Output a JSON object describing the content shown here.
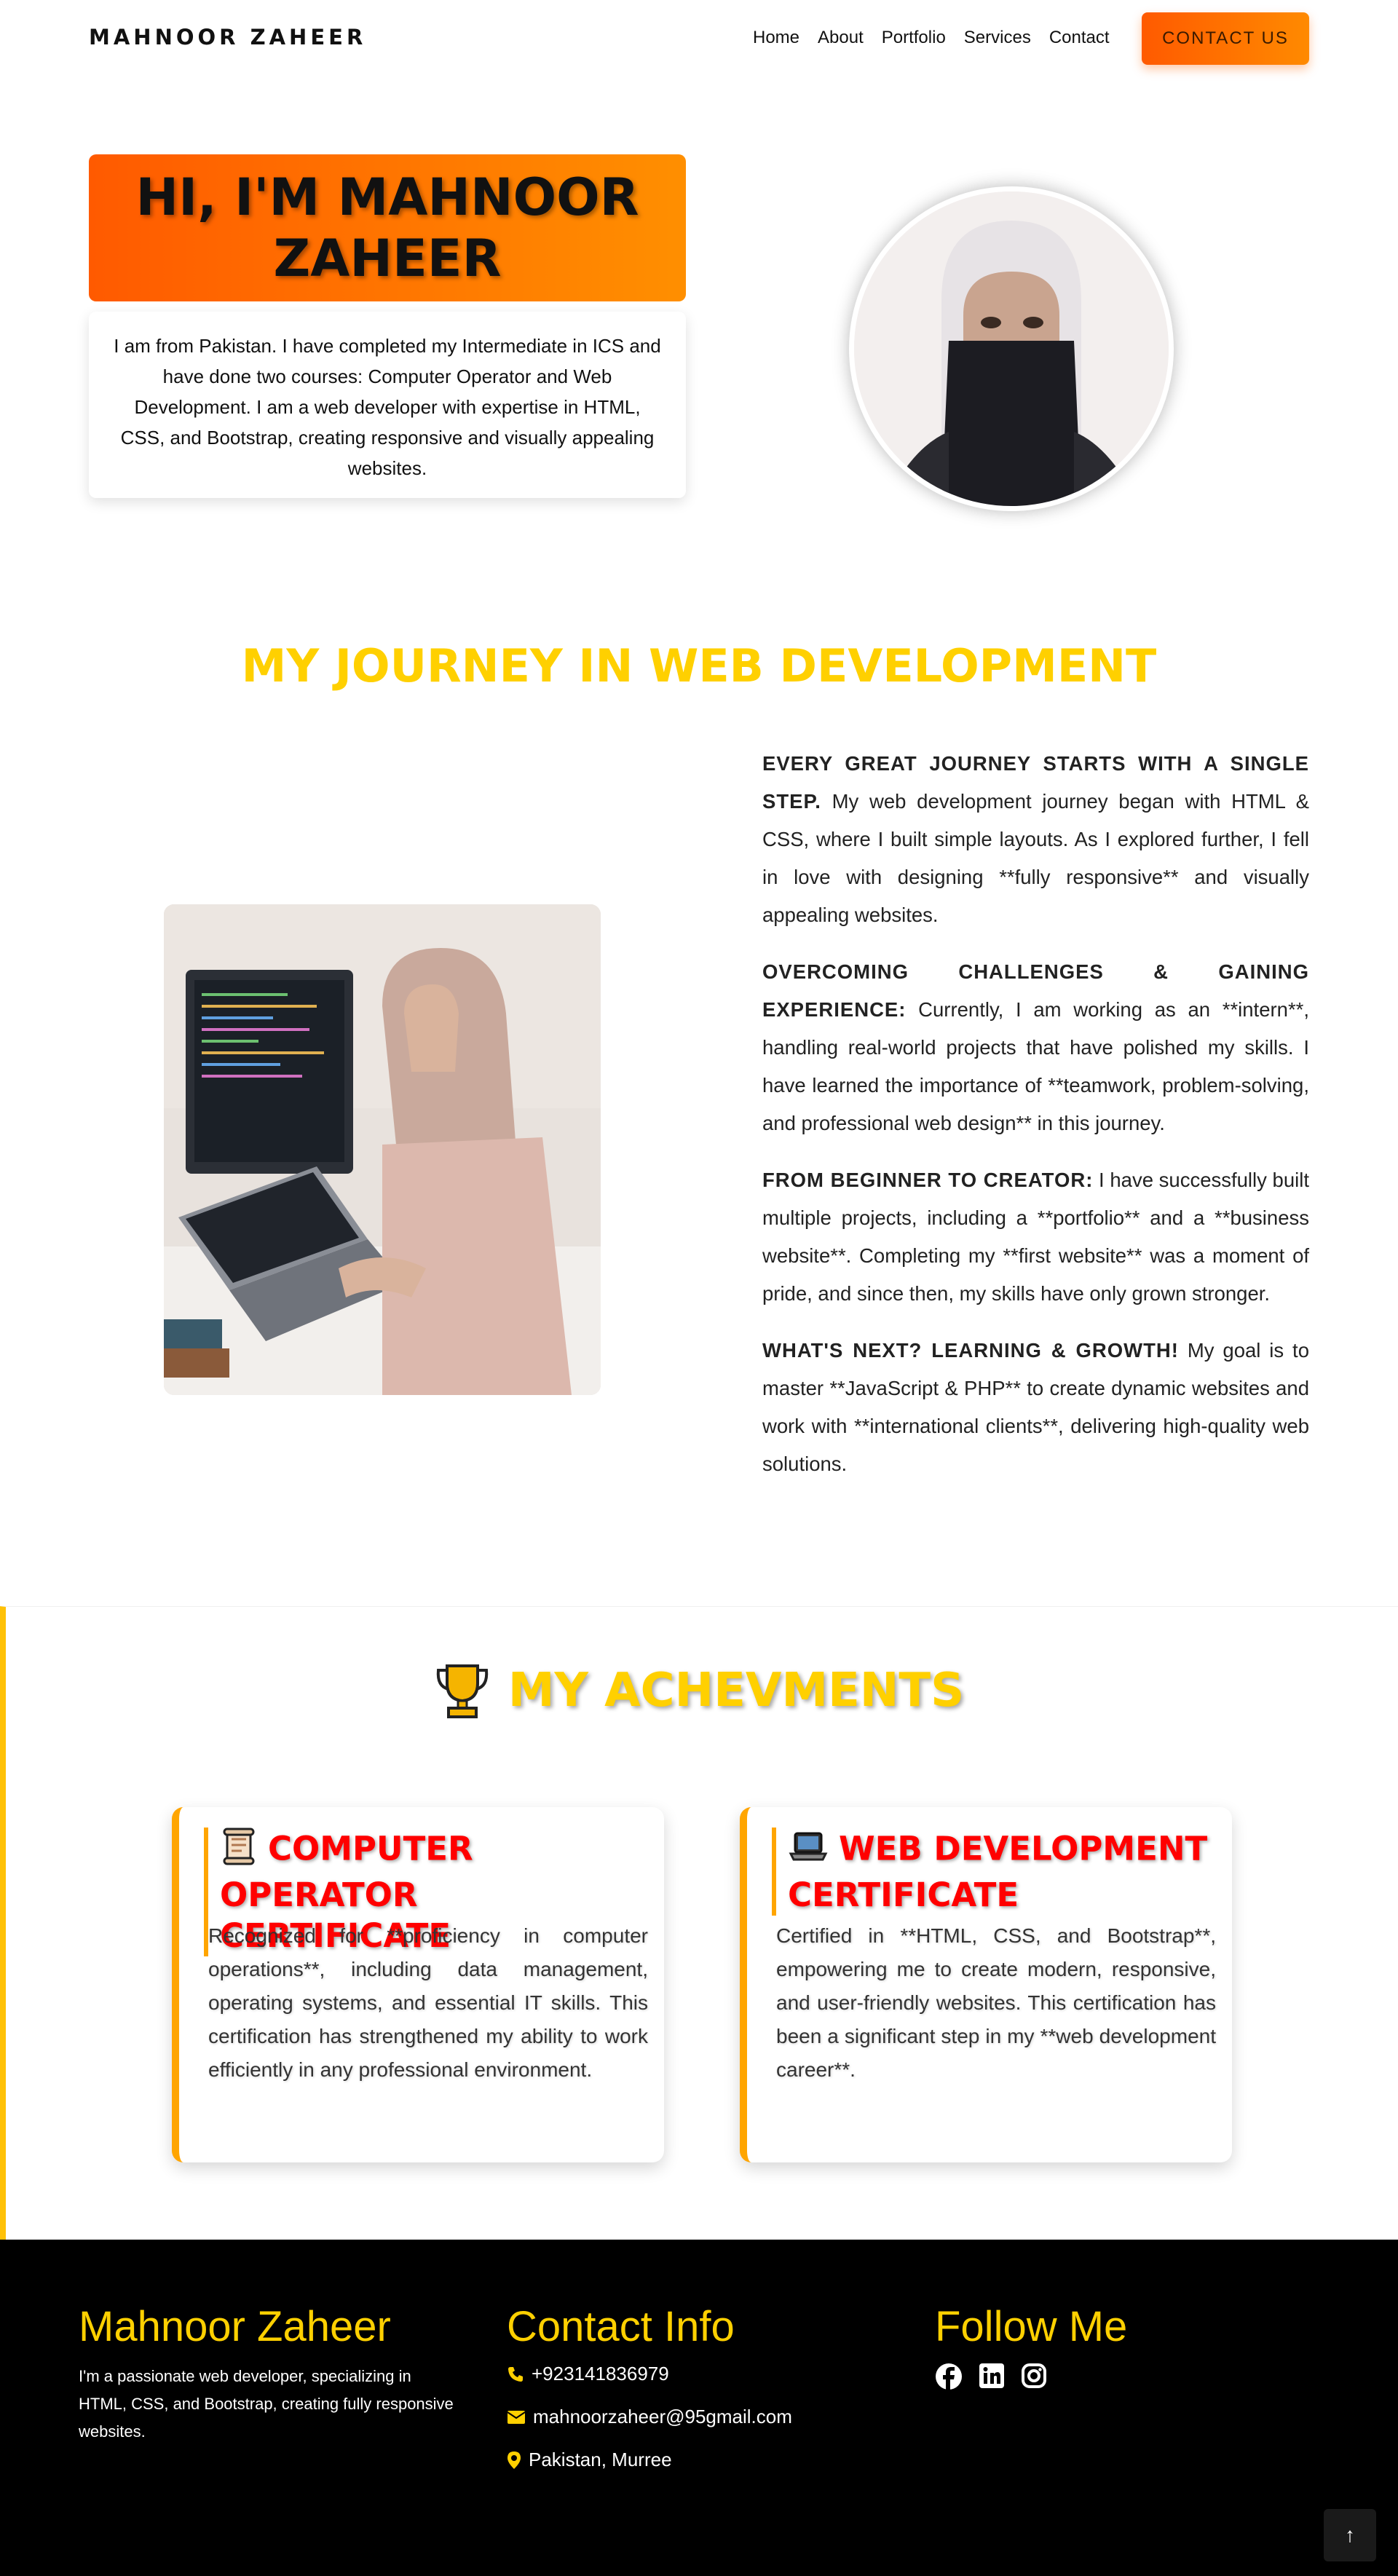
{
  "nav": {
    "brand": "MAHNOOR ZAHEER",
    "links": [
      "Home",
      "About",
      "Portfolio",
      "Services",
      "Contact"
    ],
    "cta": "CONTACT US"
  },
  "hero": {
    "title": "HI, I'M MAHNOOR ZAHEER",
    "description": "I am from Pakistan. I have completed my Intermediate in ICS and have done two courses: Computer Operator and Web Development. I am a web developer with expertise in HTML, CSS, and Bootstrap, creating responsive and visually appealing websites."
  },
  "journey": {
    "title": "MY JOURNEY IN WEB DEVELOPMENT",
    "paragraphs": [
      {
        "heading": "EVERY GREAT JOURNEY STARTS WITH A SINGLE STEP.",
        "text": " My web development journey began with HTML & CSS, where I built simple layouts. As I explored further, I fell in love with designing **fully responsive** and visually appealing websites."
      },
      {
        "heading": "OVERCOMING CHALLENGES & GAINING EXPERIENCE:",
        "text": " Currently, I am working as an **intern**, handling real-world projects that have polished my skills. I have learned the importance of **teamwork, problem-solving, and professional web design** in this journey."
      },
      {
        "heading": "FROM BEGINNER TO CREATOR:",
        "text": " I have successfully built multiple projects, including a **portfolio** and a **business website**. Completing my **first website** was a moment of pride, and since then, my skills have only grown stronger."
      },
      {
        "heading": "WHAT'S NEXT? LEARNING & GROWTH!",
        "text": " My goal is to master **JavaScript & PHP** to create dynamic websites and work with **international clients**, delivering high-quality web solutions."
      }
    ]
  },
  "achievements": {
    "title": "MY ACHEVMENTS",
    "icon": "trophy-icon",
    "cards": [
      {
        "icon": "scroll-icon",
        "title": "COMPUTER OPERATOR CERTIFICATE",
        "text": "Recognized for **proficiency in computer operations**, including data management, operating systems, and essential IT skills. This certification has strengthened my ability to work efficiently in any professional environment."
      },
      {
        "icon": "laptop-icon",
        "title": "WEB DEVELOPMENT CERTIFICATE",
        "text": "Certified in **HTML, CSS, and Bootstrap**, empowering me to create modern, responsive, and user-friendly websites. This certification has been a significant step in my **web development career**."
      }
    ]
  },
  "footer": {
    "name": "Mahnoor Zaheer",
    "about": "I'm a passionate web developer, specializing in HTML, CSS, and Bootstrap, creating fully responsive websites.",
    "contact_title": "Contact Info",
    "phone": "+923141836979",
    "email": "mahnoorzaheer@95gmail.com",
    "location": "Pakistan, Murree",
    "follow_title": "Follow Me",
    "social_icons": [
      "facebook-icon",
      "linkedin-icon",
      "instagram-icon"
    ],
    "back_to_top": "↑"
  },
  "colors": {
    "accent_orange": "#ff6a00",
    "accent_yellow": "#ffd000",
    "card_title_red": "#ff0000",
    "footer_bg": "#000000"
  }
}
